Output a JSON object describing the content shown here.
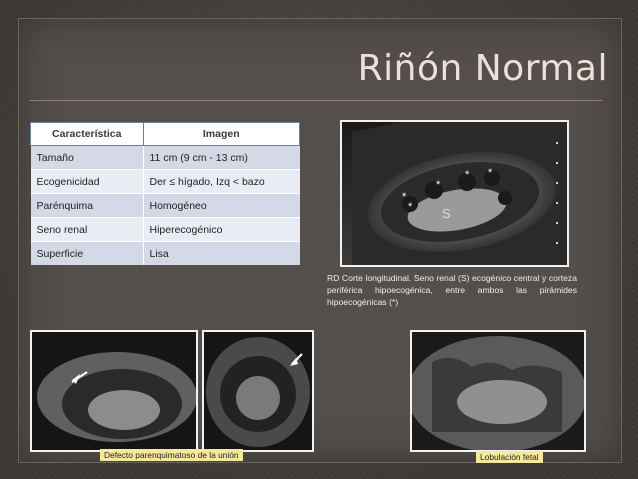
{
  "title": "Riñón Normal",
  "table": {
    "headers": [
      "Característica",
      "Imagen"
    ],
    "rows": [
      [
        "Tamaño",
        "11 cm (9 cm - 13 cm)"
      ],
      [
        "Ecogenicidad",
        "Der  ≤ hígado,  Izq  < bazo"
      ],
      [
        "Parénquima",
        "Homogéneo"
      ],
      [
        "Seno renal",
        "Hiperecogénico"
      ],
      [
        "Superficie",
        "Lisa"
      ]
    ]
  },
  "images": {
    "main": {
      "label_s": "S",
      "markers": [
        "*",
        "*",
        "*",
        "*",
        "*"
      ]
    },
    "caption_main": "RD  Corte  longitudinal.  Seno  renal  (S)  ecogénico  central  y  corteza  periférica  hipoecogénica,  entre  ambos las pirámides hipoecogénicas  (*)",
    "caption_defect": "Defecto parenquimatoso de la unión",
    "caption_lobulation": "Lobulación fetal"
  }
}
